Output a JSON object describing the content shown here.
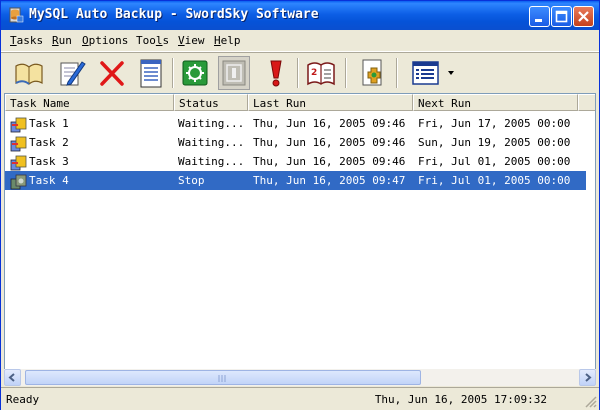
{
  "window": {
    "title": "MySQL Auto Backup - SwordSky Software"
  },
  "menu": [
    {
      "label": "Tasks",
      "key": "T",
      "rest": "asks"
    },
    {
      "label": "Run",
      "key": "R",
      "rest": "un"
    },
    {
      "label": "Options",
      "key": "O",
      "rest": "ptions"
    },
    {
      "label": "Tools",
      "key": "T",
      "rest": "ools",
      "pre": "Too",
      "mid": "l",
      "post": "s"
    },
    {
      "label": "View",
      "key": "V",
      "rest": "iew"
    },
    {
      "label": "Help",
      "key": "H",
      "rest": "elp"
    }
  ],
  "toolbar": {
    "icons": [
      "open-book-icon",
      "edit-pencil-icon",
      "delete-x-icon",
      "document-icon",
      "run-gear-icon",
      "stop-icon",
      "alert-exclamation-icon",
      "calendar-book-icon",
      "plugin-document-icon",
      "view-list-icon"
    ]
  },
  "list": {
    "columns": [
      "Task Name",
      "Status",
      "Last Run",
      "Next Run"
    ],
    "rows": [
      {
        "name": "Task 1",
        "status": "Waiting...",
        "last_run": "Thu, Jun 16, 2005 09:46",
        "next_run": "Fri, Jun 17, 2005 00:00",
        "selected": false,
        "icon": "task-waiting-icon"
      },
      {
        "name": "Task 2",
        "status": "Waiting...",
        "last_run": "Thu, Jun 16, 2005 09:46",
        "next_run": "Sun, Jun 19, 2005 00:00",
        "selected": false,
        "icon": "task-waiting-icon"
      },
      {
        "name": "Task 3",
        "status": "Waiting...",
        "last_run": "Thu, Jun 16, 2005 09:46",
        "next_run": "Fri, Jul 01, 2005 00:00",
        "selected": false,
        "icon": "task-waiting-icon"
      },
      {
        "name": "Task 4",
        "status": "Stop",
        "last_run": "Thu, Jun 16, 2005 09:47",
        "next_run": "Fri, Jul 01, 2005 00:00",
        "selected": true,
        "icon": "task-stopped-icon"
      }
    ]
  },
  "status": {
    "left": "Ready",
    "right": "Thu, Jun 16, 2005 17:09:32"
  },
  "colors": {
    "title_bar": "#0a5ef0",
    "selection": "#316ac5",
    "close_button": "#c4411c"
  }
}
